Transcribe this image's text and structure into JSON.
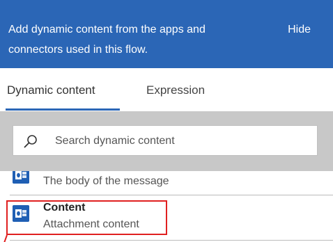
{
  "header": {
    "message": "Add dynamic content from the apps and connectors used in this flow.",
    "hide_label": "Hide"
  },
  "tabs": [
    {
      "label": "Dynamic content",
      "active": true
    },
    {
      "label": "Expression",
      "active": false
    }
  ],
  "search": {
    "placeholder": "Search dynamic content",
    "value": ""
  },
  "items": [
    {
      "title": "",
      "description": "The body of the message",
      "icon": "outlook-icon",
      "partial": true
    },
    {
      "title": "Content",
      "description": "Attachment content",
      "icon": "outlook-icon",
      "highlighted": true
    }
  ],
  "colors": {
    "header_bg": "#2b66b6",
    "accent": "#2b66b6",
    "highlight": "#e02020",
    "search_band": "#c8c8c8"
  }
}
